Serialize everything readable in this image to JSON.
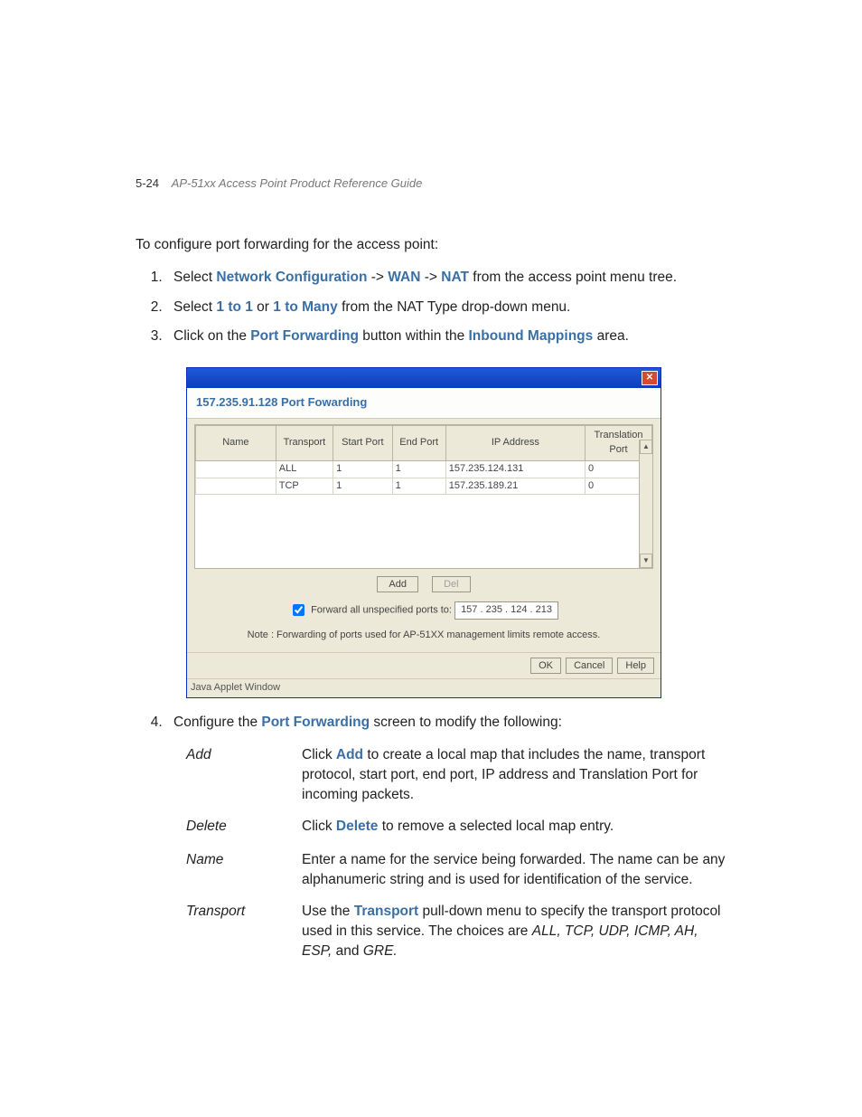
{
  "header": {
    "page_number": "5-24",
    "doc_title": "AP-51xx Access Point Product Reference Guide"
  },
  "intro": "To configure port forwarding for the access point:",
  "steps": {
    "s1_a": "Select ",
    "s1_nc": "Network Configuration",
    "s1_arrow1": " -> ",
    "s1_wan": "WAN",
    "s1_arrow2": " -> ",
    "s1_nat": "NAT",
    "s1_b": " from the access point menu tree.",
    "s2_a": "Select ",
    "s2_1to1": "1 to 1",
    "s2_or": " or ",
    "s2_1tomany": "1 to Many",
    "s2_b": " from the NAT Type drop-down menu.",
    "s3_a": "Click on the ",
    "s3_pf": "Port Forwarding",
    "s3_b": " button within the ",
    "s3_im": "Inbound Mappings",
    "s3_c": " area.",
    "s4_a": "Configure the ",
    "s4_pf": "Port Forwarding",
    "s4_b": " screen to modify the following:"
  },
  "dialog": {
    "title": "157.235.91.128 Port Fowarding",
    "columns": {
      "name": "Name",
      "transport": "Transport",
      "start_port": "Start Port",
      "end_port": "End Port",
      "ip": "IP Address",
      "trans_port": "Translation Port"
    },
    "rows": [
      {
        "name": "",
        "transport": "ALL",
        "start_port": "1",
        "end_port": "1",
        "ip": "157.235.124.131",
        "trans_port": "0"
      },
      {
        "name": "",
        "transport": "TCP",
        "start_port": "1",
        "end_port": "1",
        "ip": "157.235.189.21",
        "trans_port": "0"
      }
    ],
    "buttons": {
      "add": "Add",
      "del": "Del"
    },
    "forward_checkbox_label": "Forward all unspecified ports to:",
    "forward_ip": "157 . 235 . 124 . 213",
    "note": "Note : Forwarding of ports used for AP-51XX management limits remote access.",
    "bottom_buttons": {
      "ok": "OK",
      "cancel": "Cancel",
      "help": "Help"
    },
    "applet_status": "Java Applet Window"
  },
  "defs": {
    "add_term": "Add",
    "add_a": "Click ",
    "add_kw": "Add",
    "add_b": " to create a local map that includes the name, transport protocol, start port, end port, IP address and Translation Port for incoming packets.",
    "del_term": "Delete",
    "del_a": "Click ",
    "del_kw": "Delete",
    "del_b": " to remove a selected local map entry.",
    "name_term": "Name",
    "name_body": "Enter a name for the service being forwarded. The name can be any alphanumeric string and is used for identification of the service.",
    "trans_term": "Transport",
    "trans_a": "Use the ",
    "trans_kw": "Transport",
    "trans_b": " pull-down menu to specify the transport protocol used in this service. The choices are ",
    "trans_choices": "ALL, TCP, UDP, ICMP, AH, ESP,",
    "trans_and": " and ",
    "trans_last": "GRE."
  }
}
